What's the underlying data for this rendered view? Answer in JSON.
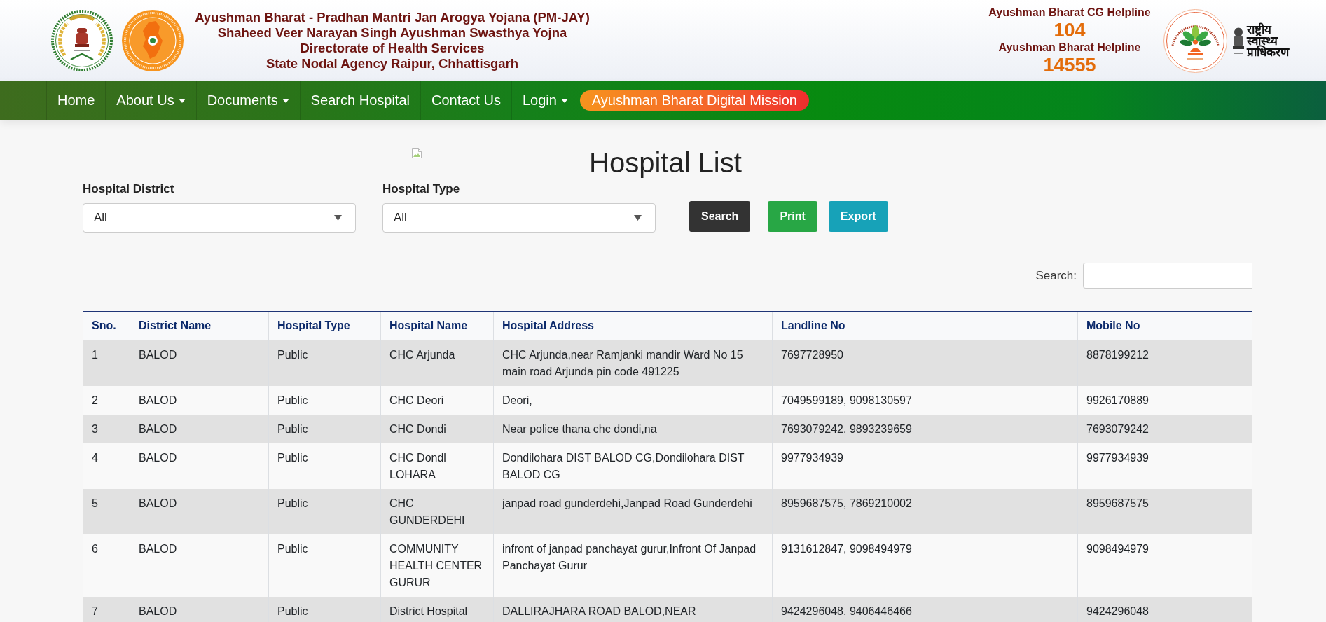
{
  "header": {
    "titles": [
      "Ayushman Bharat - Pradhan Mantri Jan Arogya Yojana (PM-JAY)",
      "Shaheed Veer Narayan Singh Ayushman Swasthya Yojna",
      "Directorate of Health Services",
      "State Nodal Agency Raipur, Chhattisgarh"
    ],
    "helplines": [
      {
        "label": "Ayushman Bharat CG Helpline",
        "number": "104"
      },
      {
        "label": "Ayushman Bharat Helpline",
        "number": "14555"
      }
    ],
    "agency_logo": {
      "lines": [
        "राष्ट्रीय",
        "स्वास्थ्य",
        "प्राधिकरण"
      ]
    }
  },
  "nav": {
    "items": [
      {
        "label": "Home",
        "kind": "link"
      },
      {
        "label": "About Us",
        "kind": "dropdown"
      },
      {
        "label": "Documents",
        "kind": "dropdown"
      },
      {
        "label": "Search Hospital",
        "kind": "link"
      },
      {
        "label": "Contact Us",
        "kind": "link"
      },
      {
        "label": "Login",
        "kind": "dropdown"
      },
      {
        "label": "Ayushman Bharat Digital Mission",
        "kind": "highlight"
      }
    ]
  },
  "page": {
    "title": "Hospital List",
    "filters": [
      {
        "label": "Hospital District",
        "value": "All"
      },
      {
        "label": "Hospital Type",
        "value": "All"
      }
    ],
    "buttons": [
      {
        "label": "Search",
        "kind": "dark"
      },
      {
        "label": "Print",
        "kind": "success"
      },
      {
        "label": "Export",
        "kind": "info"
      }
    ]
  },
  "table": {
    "search_label": "Search:",
    "columns": [
      "Sno.",
      "District Name",
      "Hospital Type",
      "Hospital Name",
      "Hospital Address",
      "Landline No",
      "Mobile No"
    ],
    "rows": [
      [
        "1",
        "BALOD",
        "Public",
        "CHC Arjunda",
        "CHC Arjunda,near Ramjanki mandir Ward No 15 main road Arjunda pin code 491225",
        "7697728950",
        "8878199212"
      ],
      [
        "2",
        "BALOD",
        "Public",
        "CHC Deori",
        "Deori,",
        "7049599189, 9098130597",
        "9926170889"
      ],
      [
        "3",
        "BALOD",
        "Public",
        "CHC Dondi",
        "Near police thana chc dondi,na",
        "7693079242, 9893239659",
        "7693079242"
      ],
      [
        "4",
        "BALOD",
        "Public",
        "CHC Dondl LOHARA",
        "Dondilohara DIST BALOD CG,Dondilohara DIST BALOD CG",
        "9977934939",
        "9977934939"
      ],
      [
        "5",
        "BALOD",
        "Public",
        "CHC GUNDERDEHI",
        "janpad road gunderdehi,Janpad Road Gunderdehi",
        "8959687575, 7869210002",
        "8959687575"
      ],
      [
        "6",
        "BALOD",
        "Public",
        "COMMUNITY HEALTH CENTER GURUR",
        "infront of janpad panchayat gurur,Infront Of Janpad Panchayat Gurur",
        "9131612847, 9098494979",
        "9098494979"
      ],
      [
        "7",
        "BALOD",
        "Public",
        "District Hospital",
        "DALLIRAJHARA ROAD BALOD,NEAR",
        "9424296048, 9406446466",
        "9424296048"
      ]
    ]
  }
}
